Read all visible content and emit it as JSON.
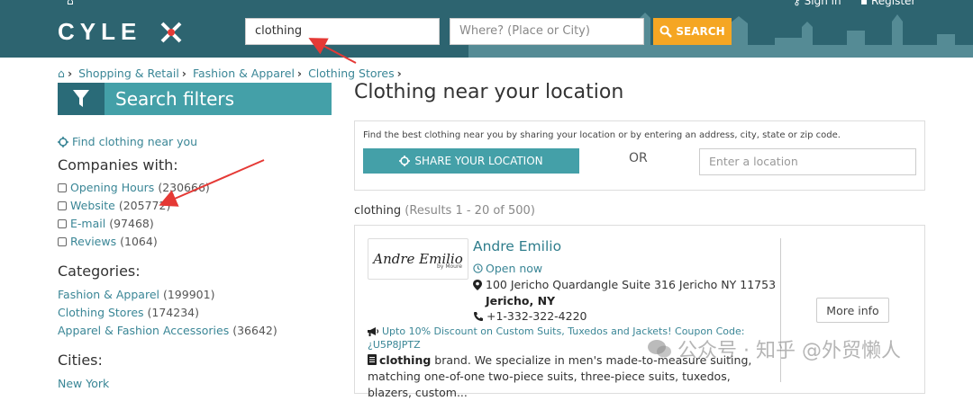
{
  "header": {
    "sign_in": "Sign in",
    "register": "Register",
    "logo_text": "CYLEX",
    "search_value": "clothing",
    "where_placeholder": "Where? (Place or City)",
    "search_button": "SEARCH"
  },
  "breadcrumb": {
    "items": [
      "Shopping & Retail",
      "Fashion & Apparel",
      "Clothing Stores"
    ]
  },
  "sidebar": {
    "filter_title": "Search filters",
    "find_link": "Find clothing near you",
    "companies_title": "Companies with:",
    "companies": [
      {
        "label": "Opening Hours",
        "count": "(230666)"
      },
      {
        "label": "Website",
        "count": "(205772)"
      },
      {
        "label": "E-mail",
        "count": "(97468)"
      },
      {
        "label": "Reviews",
        "count": "(1064)"
      }
    ],
    "categories_title": "Categories:",
    "categories": [
      {
        "label": "Fashion & Apparel",
        "count": "(199901)"
      },
      {
        "label": "Clothing Stores",
        "count": "(174234)"
      },
      {
        "label": "Apparel & Fashion Accessories",
        "count": "(36642)"
      }
    ],
    "cities_title": "Cities:",
    "cities": [
      "New York"
    ]
  },
  "main": {
    "title": "Clothing near your location",
    "location_hint": "Find the best clothing near you by sharing your location or by entering an address, city, state or zip code.",
    "share_button": "SHARE YOUR LOCATION",
    "or_text": "OR",
    "location_placeholder": "Enter a location",
    "results_query": "clothing",
    "results_count": "(Results 1 - 20 of 500)"
  },
  "listing": {
    "logo_text": "Andre Emilio",
    "logo_sub": "by Moure",
    "name": "Andre Emilio",
    "status": "Open now",
    "address_line1": "100 Jericho Quardangle Suite 316 Jericho NY 11753",
    "address_line2": "Jericho, NY",
    "phone": "+1-332-322-4220",
    "promo": "Upto 10% Discount on Custom Suits, Tuxedos and Jackets! Coupon Code: ¿U5P8JPTZ",
    "desc_bold": "clothing",
    "desc_rest": " brand. We specialize in men's made-to-measure suiting, matching one-of-one two-piece suits, three-piece suits, tuxedos, blazers, custom...",
    "more_info": "More info"
  },
  "watermark": {
    "text": "公众号 · 知乎 @外贸懒人"
  },
  "colors": {
    "header_bg": "#2d6470",
    "teal": "#44a0a8",
    "link": "#3a8696",
    "search_btn": "#f5a623",
    "arrow": "#e53935"
  }
}
